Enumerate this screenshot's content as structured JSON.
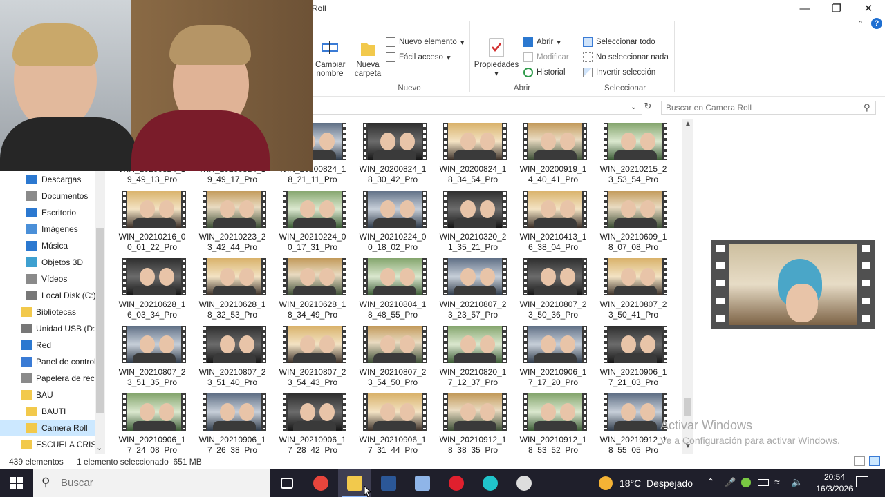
{
  "window": {
    "title": "Roll"
  },
  "ribbon": {
    "rename": {
      "line1": "Cambiar",
      "line2": "nombre"
    },
    "new_folder": {
      "line1": "Nueva",
      "line2": "carpeta"
    },
    "new_item": "Nuevo elemento",
    "easy_access": "Fácil acceso",
    "group_new": "Nuevo",
    "properties": "Propiedades",
    "open": "Abrir",
    "edit": "Modificar",
    "history": "Historial",
    "group_open": "Abrir",
    "select_all": "Seleccionar todo",
    "select_none": "No seleccionar nada",
    "invert_selection": "Invertir selección",
    "group_select": "Seleccionar"
  },
  "search": {
    "placeholder": "Buscar en Camera Roll"
  },
  "nav": {
    "items": [
      {
        "label": "Descargas",
        "icon": "download-arrow-icon"
      },
      {
        "label": "Documentos",
        "icon": "documents-icon"
      },
      {
        "label": "Escritorio",
        "icon": "desktop-icon"
      },
      {
        "label": "Imágenes",
        "icon": "pictures-icon"
      },
      {
        "label": "Música",
        "icon": "music-note-icon"
      },
      {
        "label": "Objetos 3D",
        "icon": "cube-3d-icon"
      },
      {
        "label": "Vídeos",
        "icon": "video-icon"
      },
      {
        "label": "Local Disk (C:)",
        "icon": "drive-icon"
      },
      {
        "label": "Bibliotecas",
        "icon": "libraries-icon"
      },
      {
        "label": "Unidad USB (D:)",
        "icon": "usb-drive-icon"
      },
      {
        "label": "Red",
        "icon": "network-icon"
      },
      {
        "label": "Panel de control",
        "icon": "control-panel-icon"
      },
      {
        "label": "Papelera de reciclaje",
        "icon": "recycle-bin-icon"
      },
      {
        "label": "BAU",
        "icon": "folder-icon"
      },
      {
        "label": "BAUTI",
        "icon": "folder-icon"
      },
      {
        "label": "Camera Roll",
        "icon": "folder-icon"
      },
      {
        "label": "ESCUELA CRIS",
        "icon": "folder-icon"
      }
    ]
  },
  "files": [
    {
      "l1": "WIN_20200824_1",
      "l2": "9_49_13_Pro"
    },
    {
      "l1": "WIN_20200824_1",
      "l2": "9_49_17_Pro"
    },
    {
      "l1": "WIN_20200824_1",
      "l2": "8_21_11_Pro"
    },
    {
      "l1": "WIN_20200824_1",
      "l2": "8_30_42_Pro"
    },
    {
      "l1": "WIN_20200824_1",
      "l2": "8_34_54_Pro"
    },
    {
      "l1": "WIN_20200919_1",
      "l2": "4_40_41_Pro"
    },
    {
      "l1": "WIN_20210215_2",
      "l2": "3_53_54_Pro"
    },
    {
      "l1": "WIN_20210216_0",
      "l2": "0_01_22_Pro"
    },
    {
      "l1": "WIN_20210223_2",
      "l2": "3_42_44_Pro"
    },
    {
      "l1": "WIN_20210224_0",
      "l2": "0_17_31_Pro"
    },
    {
      "l1": "WIN_20210224_0",
      "l2": "0_18_02_Pro"
    },
    {
      "l1": "WIN_20210320_2",
      "l2": "1_35_21_Pro"
    },
    {
      "l1": "WIN_20210413_1",
      "l2": "6_38_04_Pro"
    },
    {
      "l1": "WIN_20210609_1",
      "l2": "8_07_08_Pro"
    },
    {
      "l1": "WIN_20210628_1",
      "l2": "6_03_34_Pro"
    },
    {
      "l1": "WIN_20210628_1",
      "l2": "8_32_53_Pro"
    },
    {
      "l1": "WIN_20210628_1",
      "l2": "8_34_49_Pro"
    },
    {
      "l1": "WIN_20210804_1",
      "l2": "8_48_55_Pro"
    },
    {
      "l1": "WIN_20210807_2",
      "l2": "3_23_57_Pro"
    },
    {
      "l1": "WIN_20210807_2",
      "l2": "3_50_36_Pro"
    },
    {
      "l1": "WIN_20210807_2",
      "l2": "3_50_41_Pro"
    },
    {
      "l1": "WIN_20210807_2",
      "l2": "3_51_35_Pro"
    },
    {
      "l1": "WIN_20210807_2",
      "l2": "3_51_40_Pro"
    },
    {
      "l1": "WIN_20210807_2",
      "l2": "3_54_43_Pro"
    },
    {
      "l1": "WIN_20210807_2",
      "l2": "3_54_50_Pro"
    },
    {
      "l1": "WIN_20210820_1",
      "l2": "7_12_37_Pro"
    },
    {
      "l1": "WIN_20210906_1",
      "l2": "7_17_20_Pro"
    },
    {
      "l1": "WIN_20210906_1",
      "l2": "7_21_03_Pro"
    },
    {
      "l1": "WIN_20210906_1",
      "l2": "7_24_08_Pro"
    },
    {
      "l1": "WIN_20210906_1",
      "l2": "7_26_38_Pro"
    },
    {
      "l1": "WIN_20210906_1",
      "l2": "7_28_42_Pro"
    },
    {
      "l1": "WIN_20210906_1",
      "l2": "7_31_44_Pro"
    },
    {
      "l1": "WIN_20210912_1",
      "l2": "8_38_35_Pro"
    },
    {
      "l1": "WIN_20210912_1",
      "l2": "8_53_52_Pro"
    },
    {
      "l1": "WIN_20210912_1",
      "l2": "8_55_05_Pro"
    }
  ],
  "watermark": {
    "line1": "Activar Windows",
    "line2": "Ve a Configuración para activar Windows."
  },
  "status": {
    "count": "439 elementos",
    "selection": "1 elemento seleccionado  651 MB"
  },
  "taskbar": {
    "search_placeholder": "Buscar",
    "weather": "18°C  Despejado",
    "time": "20:54",
    "date": "16/3/2026",
    "apps": [
      {
        "name": "task-view-icon",
        "active": false
      },
      {
        "name": "chrome-icon",
        "active": false
      },
      {
        "name": "file-explorer-icon",
        "active": true
      },
      {
        "name": "word-icon",
        "active": false
      },
      {
        "name": "paint-icon",
        "active": false
      },
      {
        "name": "opera-icon",
        "active": false
      },
      {
        "name": "canva-icon",
        "active": false
      },
      {
        "name": "obs-icon",
        "active": false
      }
    ]
  },
  "colors": {
    "accent": "#0078d7",
    "selection": "#cce8ff",
    "taskbar": "#1f1f2b"
  }
}
